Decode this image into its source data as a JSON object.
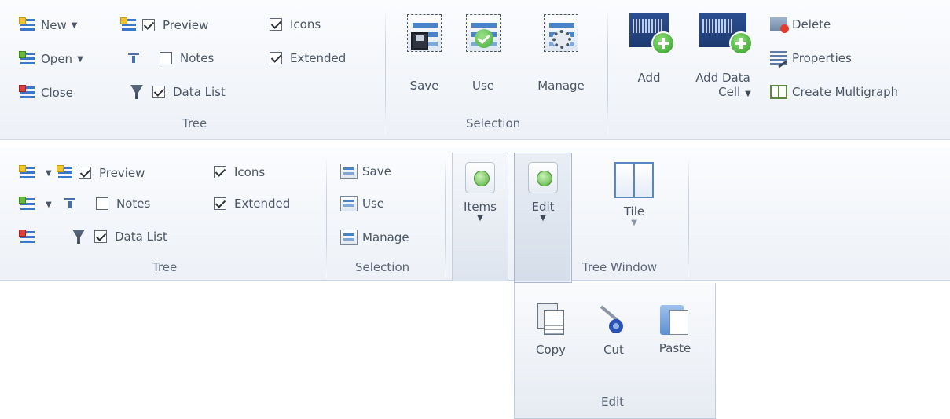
{
  "ribbon1": {
    "tree": {
      "new_label": "New",
      "open_label": "Open",
      "close_label": "Close",
      "preview_label": "Preview",
      "notes_label": "Notes",
      "datalist_label": "Data List",
      "icons_label": "Icons",
      "extended_label": "Extended",
      "group_label": "Tree",
      "preview_checked": true,
      "notes_checked": false,
      "datalist_checked": true,
      "icons_checked": true,
      "extended_checked": true
    },
    "selection": {
      "save_label": "Save",
      "use_label": "Use",
      "manage_label": "Manage",
      "group_label": "Selection"
    },
    "data": {
      "add_label": "Add",
      "add_data_line1": "Add Data",
      "add_data_line2": "Cell",
      "delete_label": "Delete",
      "properties_label": "Properties",
      "multigraph_label": "Create Multigraph"
    }
  },
  "ribbon2": {
    "tree": {
      "preview_label": "Preview",
      "notes_label": "Notes",
      "datalist_label": "Data List",
      "icons_label": "Icons",
      "extended_label": "Extended",
      "group_label": "Tree"
    },
    "selection": {
      "save_label": "Save",
      "use_label": "Use",
      "manage_label": "Manage",
      "group_label": "Selection"
    },
    "items_label": "Items",
    "edit_label": "Edit",
    "tree_window": {
      "tile_label": "Tile",
      "group_label": "Tree Window"
    }
  },
  "edit_panel": {
    "copy_label": "Copy",
    "cut_label": "Cut",
    "paste_label": "Paste",
    "group_label": "Edit"
  },
  "colors": {
    "ribbon_top": "#fbfcfe",
    "ribbon_bottom": "#edf1f7",
    "accent_green": "#56b03f",
    "accent_blue": "#4a84c8"
  }
}
